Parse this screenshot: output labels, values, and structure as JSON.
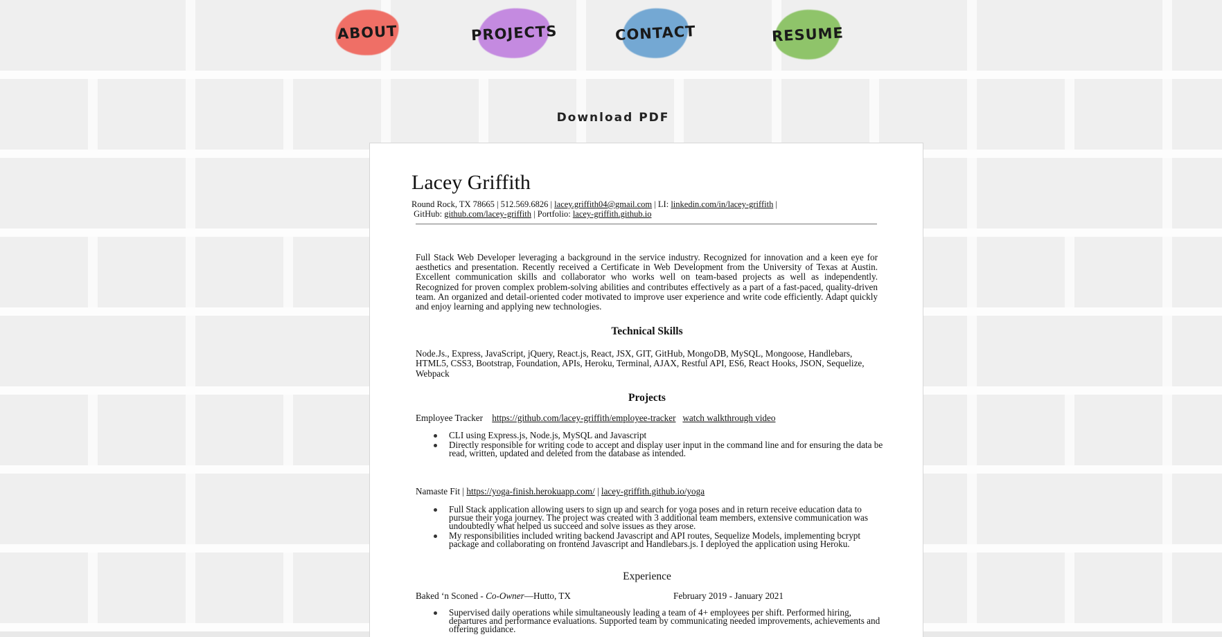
{
  "nav": {
    "items": [
      {
        "label": "ABOUT",
        "color": "#ef6f66"
      },
      {
        "label": "PROJECTS",
        "color": "#c48ae0"
      },
      {
        "label": "CONTACT",
        "color": "#74a8d3"
      },
      {
        "label": "RESUME",
        "color": "#8fc46a"
      }
    ]
  },
  "download_label": "Download PDF",
  "resume": {
    "name": "Lacey Griffith",
    "contact": {
      "location_phone": "Round Rock, TX 78665 | 512.569.6826 |",
      "email": "lacey.griffith04@gmail.com",
      "li_prefix": "| LI:",
      "linkedin": "linkedin.com/in/lacey-griffith",
      "sep1": "|",
      "github_prefix": "GitHub:",
      "github": "github.com/lacey-griffith",
      "portfolio_prefix": "| Portfolio:",
      "portfolio": "lacey-griffith.github.io"
    },
    "summary": "Full Stack Web Developer leveraging a background in the service industry. Recognized for innovation and a keen eye for aesthetics and presentation. Recently received a Certificate in Web Development from the University of Texas at Austin. Excellent communication skills and collaborator who works well on team-based projects as well as independently. Recognized for proven complex problem-solving abilities and contributes effectively as a part of a fast-paced, quality-driven team. An organized and detail-oriented coder motivated to improve user experience and write code efficiently. Adapt quickly and enjoy learning and applying new technologies.",
    "skills_title": "Technical Skills",
    "skills": "Node.Js., Express, JavaScript, jQuery, React.js, React, JSX, GIT, GitHub, MongoDB, MySQL, Mongoose, Handlebars, HTML5, CSS3, Bootstrap, Foundation, APIs, Heroku, Terminal, AJAX, Restful API, ES6, React Hooks, JSON, Sequelize, Webpack",
    "projects_title": "Projects",
    "project1": {
      "name": "Employee Tracker",
      "link": "https://github.com/lacey-griffith/employee-tracker",
      "video": "watch walkthrough video",
      "bullets": [
        "CLI using Express.js, Node.js, MySQL and Javascript",
        "Directly responsible for writing code to accept and display user input in the command line  and for ensuring the data be read, written, updated and deleted from the database as intended."
      ]
    },
    "project2": {
      "name": "Namaste Fit |",
      "link": "https://yoga-finish.herokuapp.com/",
      "sep": "|",
      "link2": "lacey-griffith.github.io/yoga",
      "bullets": [
        "Full Stack application allowing users to sign up and search for yoga poses and in return receive education data to pursue their yoga journey. The project was created with 3 additional team members, extensive communication was undoubtedly what helped us succeed and solve issues as they arose.",
        "My responsibilities included writing backend Javascript and API routes, Sequelize Models, implementing bcrypt package and collaborating on frontend Javascript and Handlebars.js. I deployed the application using Heroku."
      ]
    },
    "experience_title": "Experience",
    "job1": {
      "company": "Baked ‘n Sconed -",
      "role": "Co-Owner",
      "location": "—Hutto, TX",
      "dates": "February 2019 - January 2021",
      "bullets": [
        "Supervised daily operations while simultaneously leading a team of 4+ employees per shift. Performed hiring, departures and performance evaluations. Supported team by communicating needed improvements, achievements and offering guidance."
      ]
    }
  }
}
